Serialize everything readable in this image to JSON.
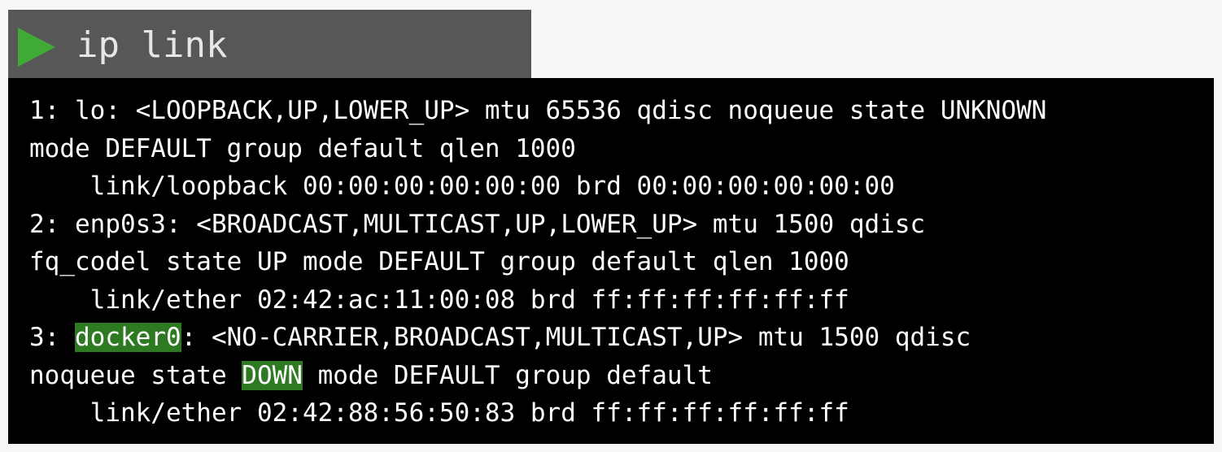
{
  "command_bar": {
    "icon": "play-icon",
    "command": "ip link",
    "colors": {
      "background": "#575757",
      "icon": "#3faa35",
      "text": "#e6e6e6"
    }
  },
  "terminal": {
    "colors": {
      "background": "#000000",
      "text": "#ffffff",
      "highlight": "#2d7a23"
    },
    "lines": [
      "1: lo: <LOOPBACK,UP,LOWER_UP> mtu 65536 qdisc noqueue state UNKNOWN",
      "mode DEFAULT group default qlen 1000",
      "    link/loopback 00:00:00:00:00:00 brd 00:00:00:00:00:00",
      "2: enp0s3: <BROADCAST,MULTICAST,UP,LOWER_UP> mtu 1500 qdisc",
      "fq_codel state UP mode DEFAULT group default qlen 1000",
      "    link/ether 02:42:ac:11:00:08 brd ff:ff:ff:ff:ff:ff"
    ],
    "line7": {
      "prefix": "3: ",
      "interface": "docker0",
      "rest": ": <NO-CARRIER,BROADCAST,MULTICAST,UP> mtu 1500 qdisc"
    },
    "line8": {
      "prefix": "noqueue state ",
      "state": "DOWN",
      "rest": " mode DEFAULT group default"
    },
    "line9": "    link/ether 02:42:88:56:50:83 brd ff:ff:ff:ff:ff:ff"
  }
}
